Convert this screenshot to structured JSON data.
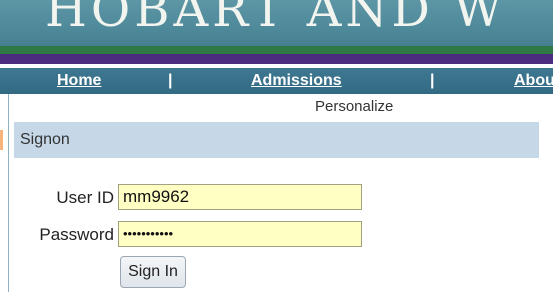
{
  "banner": {
    "title": "HOBART AND W"
  },
  "nav": {
    "items": [
      "Home",
      "Admissions",
      "Abou"
    ],
    "separator": "|"
  },
  "personalize_label": "Personalize",
  "signon": {
    "title": "Signon",
    "user_id_label": "User ID",
    "user_id_value": "mm9962",
    "password_label": "Password",
    "password_value": "•••••••••••",
    "button_label": "Sign In"
  },
  "colors": {
    "banner": "#4f8a9b",
    "green_stripe": "#2f7a44",
    "purple_stripe": "#4b2c7f",
    "nav_bar": "#3a7189",
    "panel_header": "#c6d8e8",
    "field_background": "#ffffc4"
  }
}
